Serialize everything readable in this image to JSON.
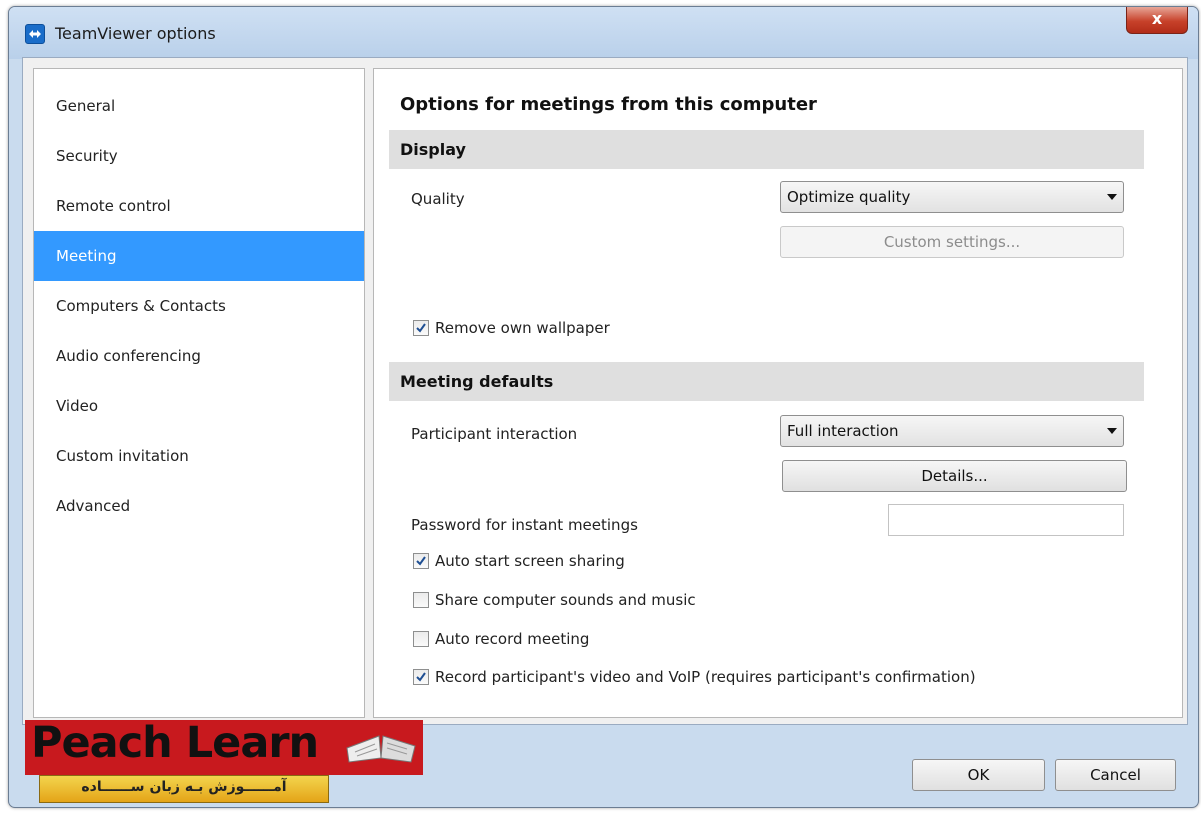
{
  "window": {
    "title": "TeamViewer options",
    "close_label": "x"
  },
  "sidebar": {
    "items": [
      {
        "label": "General",
        "active": false
      },
      {
        "label": "Security",
        "active": false
      },
      {
        "label": "Remote control",
        "active": false
      },
      {
        "label": "Meeting",
        "active": true
      },
      {
        "label": "Computers & Contacts",
        "active": false
      },
      {
        "label": "Audio conferencing",
        "active": false
      },
      {
        "label": "Video",
        "active": false
      },
      {
        "label": "Custom invitation",
        "active": false
      },
      {
        "label": "Advanced",
        "active": false
      }
    ]
  },
  "panel": {
    "title": "Options for meetings from this computer",
    "display": {
      "header": "Display",
      "quality_label": "Quality",
      "quality_value": "Optimize quality",
      "custom_settings_label": "Custom settings...",
      "remove_wallpaper": {
        "label": "Remove own wallpaper",
        "checked": true
      }
    },
    "meeting_defaults": {
      "header": "Meeting defaults",
      "participant_label": "Participant interaction",
      "participant_value": "Full interaction",
      "details_label": "Details...",
      "password_label": "Password for instant meetings",
      "password_value": "",
      "checkboxes": [
        {
          "label": "Auto start screen sharing",
          "checked": true
        },
        {
          "label": "Share computer sounds and music",
          "checked": false
        },
        {
          "label": "Auto record meeting",
          "checked": false
        },
        {
          "label": "Record participant's video and VoIP (requires participant's confirmation)",
          "checked": true
        }
      ]
    }
  },
  "footer": {
    "ok_label": "OK",
    "cancel_label": "Cancel"
  },
  "watermark": {
    "brand": "Peach Learn",
    "tagline": "آمــــــوزش بـه زبان ســــــاده"
  },
  "colors": {
    "selected": "#3399ff",
    "section": "#dfdfdf",
    "logo_red": "#c8191e",
    "logo_yellow": "#e4a418"
  }
}
